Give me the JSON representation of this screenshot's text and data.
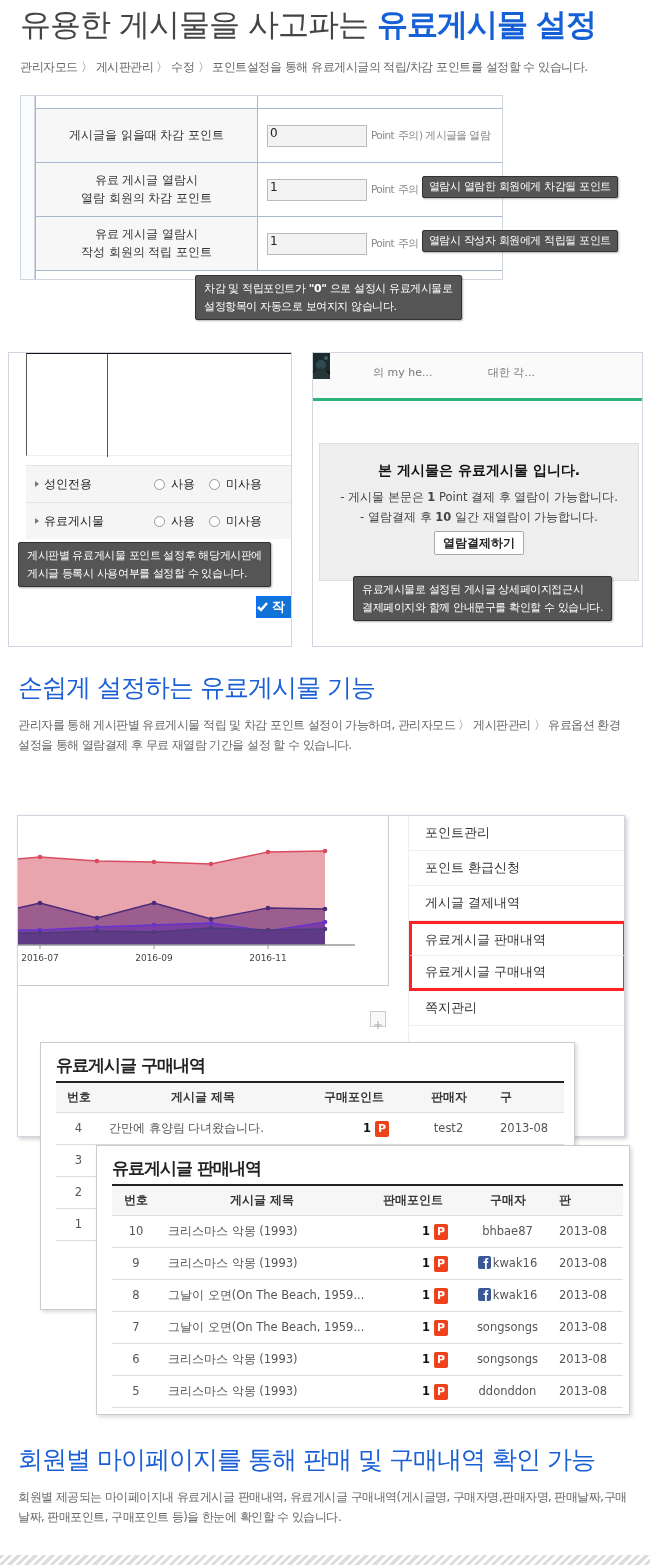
{
  "header": {
    "title_plain": "유용한 게시물을 사고파는",
    "title_highlight": "유료게시물 설정",
    "subtitle": "관리자모드 〉 게시판관리 〉 수정 〉 포인트설정을 통해 유료게시글의 적립/차감 포인트를 설정할 수 있습니다."
  },
  "settings": {
    "rows": [
      {
        "label_lines": [
          "게시글을 읽을때 차감 포인트"
        ],
        "value": "0",
        "unit": "Point",
        "note": "주의) 게시글을 열람"
      },
      {
        "label_lines": [
          "유료 게시글 열람시",
          "열람 회원의 차감 포인트"
        ],
        "value": "1",
        "unit": "Point",
        "note": "주의",
        "tooltip": "열람시 열람한 회원에게 차감될 포인트"
      },
      {
        "label_lines": [
          "유료 게시글 열람시",
          "작성 회원의 적립 포인트"
        ],
        "value": "1",
        "unit": "Point",
        "note": "주의",
        "tooltip": "열람시 작성자 회원에게 적립될 포인트"
      }
    ],
    "tooltip_lines": [
      "차감 및 적립포인트가 **\"0\"** 으로 설정시 유료게시물로",
      "설정항목이 자동으로 보여지지 않습니다."
    ]
  },
  "board_options": {
    "options": [
      {
        "label": "성인전용",
        "choices": [
          {
            "label": "사용",
            "selected": false
          },
          {
            "label": "미사용",
            "selected": false
          }
        ]
      },
      {
        "label": "유료게시물",
        "choices": [
          {
            "label": "사용",
            "selected": false
          },
          {
            "label": "미사용",
            "selected": false
          }
        ]
      }
    ],
    "tooltip_lines": [
      "게시판별 유료게시물 포인트 설정후 해당게시판에",
      "게시글 등록시 사용여부를 설정할 수 있습니다."
    ],
    "submit_label": "작"
  },
  "paywall": {
    "cut_titles": [
      "의 my he...",
      "대한 각..."
    ],
    "title": "본 게시물은 유료게시물 입니다.",
    "lines": [
      "- 게시물 본문은 **1** Point 결제 후 열람이 가능합니다.",
      "- 열람결제 후 **10** 일간 재열람이 가능합니다."
    ],
    "button": "열람결제하기",
    "tooltip_lines": [
      "유료게시물로 설정된 게시글 상세페이지접근시",
      "결제페이지와 함께 안내문구를 확인할 수 있습니다."
    ]
  },
  "feature": {
    "heading": "손쉽게 설정하는 유료게시물 기능",
    "description": "관리자를 통해 게시판별 유료게시물 적립 및 차감 포인트 설정이 가능하며, 관리자모드 〉 게시판관리 〉 유료옵션 환경 설정을 통해 열람결제 후 무료 재열람 기간을 설정 할 수 있습니다."
  },
  "mypage": {
    "chart": {
      "x_labels": [
        "2016-07",
        "2016-09",
        "2016-11"
      ]
    },
    "menu": [
      {
        "label": "포인트관리",
        "highlighted": false
      },
      {
        "label": "포인트 환급신청",
        "highlighted": false
      },
      {
        "label": "게시글 결제내역",
        "highlighted": false
      },
      {
        "label": "유료게시글 판매내역",
        "highlighted": true
      },
      {
        "label": "유료게시글 구매내역",
        "highlighted": true
      },
      {
        "label": "쪽지관리",
        "highlighted": false
      }
    ],
    "purchase": {
      "title": "유료게시글 구매내역",
      "columns": [
        "번호",
        "게시글 제목",
        "구매포인트",
        "판매자",
        "구"
      ],
      "rows": [
        {
          "no": "4",
          "title": "간만에 휴양림 다녀왔습니다.",
          "points": "1",
          "badge": "P",
          "user": "test2",
          "facebook": false,
          "date": "2013-08"
        },
        {
          "no": "3"
        },
        {
          "no": "2"
        },
        {
          "no": "1"
        }
      ]
    },
    "sales": {
      "title": "유료게시글 판매내역",
      "columns": [
        "번호",
        "게시글 제목",
        "판매포인트",
        "구매자",
        "판"
      ],
      "rows": [
        {
          "no": "10",
          "title": "크리스마스 악몽 (1993)",
          "points": "1",
          "badge": "P",
          "user": "bhbae87",
          "facebook": false,
          "date": "2013-08"
        },
        {
          "no": "9",
          "title": "크리스마스 악몽 (1993)",
          "points": "1",
          "badge": "P",
          "user": "kwak16",
          "facebook": true,
          "date": "2013-08"
        },
        {
          "no": "8",
          "title": "그날이 오면(On The Beach, 1959...",
          "points": "1",
          "badge": "P",
          "user": "kwak16",
          "facebook": true,
          "date": "2013-08"
        },
        {
          "no": "7",
          "title": "그날이 오면(On The Beach, 1959...",
          "points": "1",
          "badge": "P",
          "user": "songsongs",
          "facebook": false,
          "date": "2013-08"
        },
        {
          "no": "6",
          "title": "크리스마스 악몽 (1993)",
          "points": "1",
          "badge": "P",
          "user": "songsongs",
          "facebook": false,
          "date": "2013-08"
        },
        {
          "no": "5",
          "title": "크리스마스 악몽 (1993)",
          "points": "1",
          "badge": "P",
          "user": "ddonddon",
          "facebook": false,
          "date": "2013-08"
        }
      ]
    }
  },
  "summary": {
    "heading": "회원별 마이페이지를 통해 판매 및 구매내역 확인 가능",
    "description": "회원별 제공되는 마이페이지내 유료게시글 판매내역, 유료게시글 구매내역(게시글명, 구매자명,판매자명, 판매날짜,구매날짜, 판매포인트, 구매포인트 등)을 한눈에 확인할 수 있습니다."
  }
}
